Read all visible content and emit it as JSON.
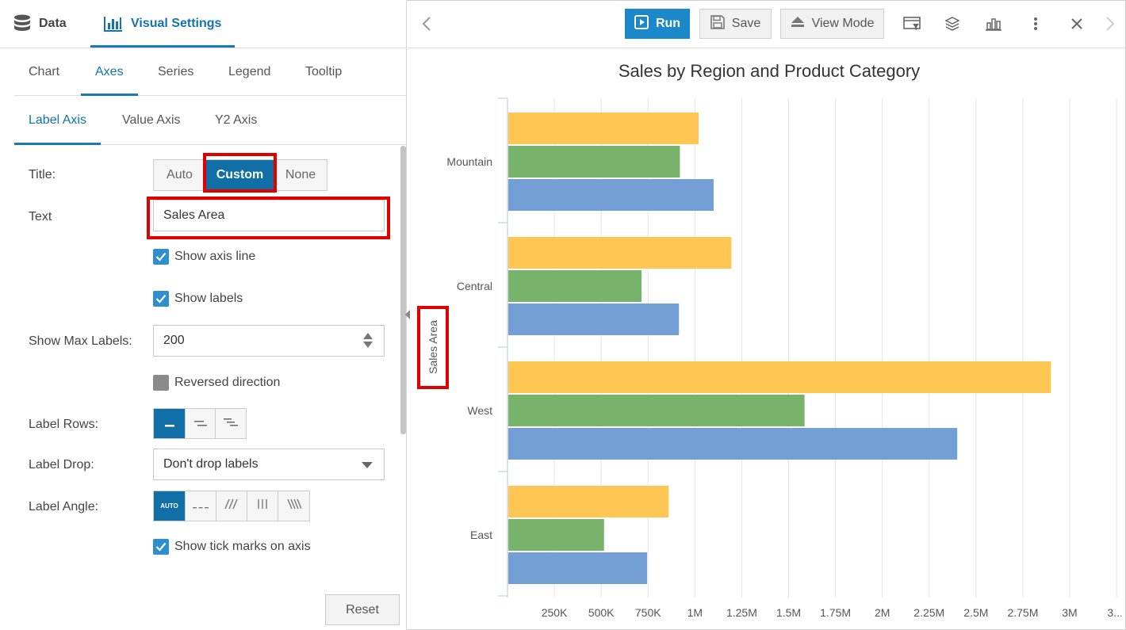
{
  "top_tabs": {
    "data": "Data",
    "visual": "Visual Settings"
  },
  "tabs": [
    "Chart",
    "Axes",
    "Series",
    "Legend",
    "Tooltip"
  ],
  "axis_tabs": [
    "Label Axis",
    "Value Axis",
    "Y2 Axis"
  ],
  "form": {
    "title_label": "Title:",
    "title_options": [
      "Auto",
      "Custom",
      "None"
    ],
    "text_label": "Text",
    "text_value": "Sales Area",
    "show_axis_line": "Show axis line",
    "show_labels": "Show labels",
    "max_labels_label": "Show Max Labels:",
    "max_labels_value": "200",
    "reversed": "Reversed direction",
    "label_rows": "Label Rows:",
    "label_drop": "Label Drop:",
    "label_drop_value": "Don't drop labels",
    "label_angle": "Label Angle:",
    "angle_auto": "AUTO",
    "show_ticks": "Show tick marks on axis",
    "reset": "Reset"
  },
  "toolbar": {
    "run": "Run",
    "save": "Save",
    "view_mode": "View Mode"
  },
  "colors": {
    "accent": "#1a88c9",
    "yellow": "#fec653",
    "green": "#78b36b",
    "blue": "#749fd4"
  },
  "chart_data": {
    "type": "bar",
    "orientation": "horizontal",
    "title": "Sales by Region and Product Category",
    "ylabel": "Sales Area",
    "categories": [
      "Mountain",
      "Central",
      "West",
      "East"
    ],
    "series": [
      {
        "color": "#fec653",
        "values": [
          1020000,
          1195000,
          2900000,
          860000
        ]
      },
      {
        "color": "#78b36b",
        "values": [
          920000,
          715000,
          1585000,
          515000
        ]
      },
      {
        "color": "#749fd4",
        "values": [
          1100000,
          915000,
          2400000,
          745000
        ]
      }
    ],
    "xticks": [
      "250K",
      "500K",
      "750K",
      "1M",
      "1.25M",
      "1.5M",
      "1.75M",
      "2M",
      "2.25M",
      "2.5M",
      "2.75M",
      "3M",
      "3...."
    ],
    "xlim": [
      0,
      3250000
    ],
    "grid": true
  }
}
